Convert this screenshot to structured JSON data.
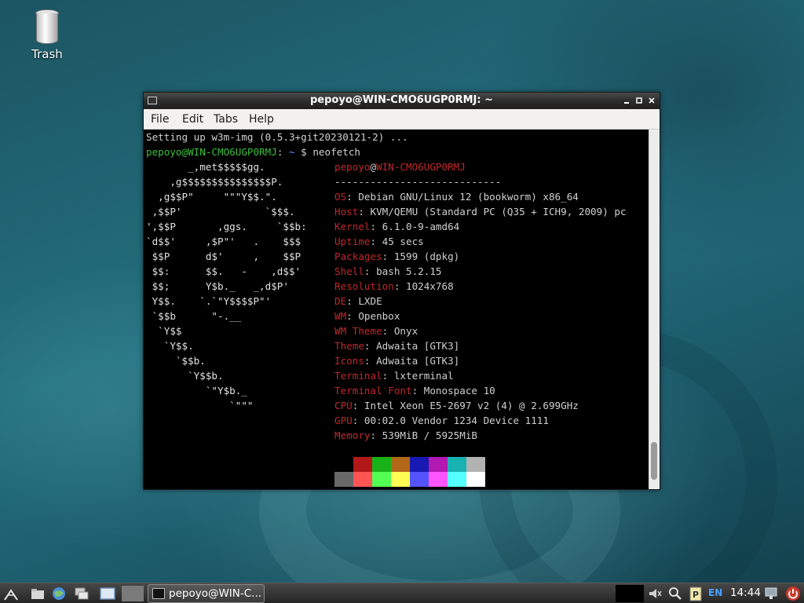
{
  "desktop": {
    "icons": [
      {
        "label": "Trash",
        "icon": "trash-icon"
      }
    ]
  },
  "window": {
    "title": "pepoyo@WIN-CMO6UGP0RMJ: ~",
    "menu": [
      "File",
      "Edit",
      "Tabs",
      "Help"
    ]
  },
  "terminal": {
    "setup_line": "Setting up w3m-img (0.5.3+git20230121-2) ...",
    "prompt_user": "pepoyo@WIN-CMO6UGP0RMJ",
    "prompt_sep": ":",
    "prompt_path": " ~",
    "prompt_symbol": " $ ",
    "command": "neofetch",
    "logo": [
      "       _,met$$$$$gg.",
      "    ,g$$$$$$$$$$$$$$$P.",
      "  ,g$$P\"     \"\"\"Y$$.\".",
      " ,$$P'              `$$$.",
      "',$$P       ,ggs.     `$$b:",
      "`d$$'     ,$P\"'   .    $$$",
      " $$P      d$'     ,    $$P",
      " $$:      $$.   -    ,d$$'",
      " $$;      Y$b._   _,d$P'",
      " Y$$.    `.`\"Y$$$$P\"'",
      " `$$b      \"-.__",
      "  `Y$$",
      "   `Y$$.",
      "     `$$b.",
      "       `Y$$b.",
      "          `\"Y$b._",
      "              `\"\"\""
    ],
    "host_user": "pepoyo",
    "host_at": "@",
    "host_name": "WIN-CMO6UGP0RMJ",
    "separator": "----------------------------",
    "info": [
      {
        "key": "OS",
        "value": "Debian GNU/Linux 12 (bookworm) x86_64"
      },
      {
        "key": "Host",
        "value": "KVM/QEMU (Standard PC (Q35 + ICH9, 2009) pc"
      },
      {
        "key": "Kernel",
        "value": "6.1.0-9-amd64"
      },
      {
        "key": "Uptime",
        "value": "45 secs"
      },
      {
        "key": "Packages",
        "value": "1599 (dpkg)"
      },
      {
        "key": "Shell",
        "value": "bash 5.2.15"
      },
      {
        "key": "Resolution",
        "value": "1024x768"
      },
      {
        "key": "DE",
        "value": "LXDE"
      },
      {
        "key": "WM",
        "value": "Openbox"
      },
      {
        "key": "WM Theme",
        "value": "Onyx"
      },
      {
        "key": "Theme",
        "value": "Adwaita [GTK3]"
      },
      {
        "key": "Icons",
        "value": "Adwaita [GTK3]"
      },
      {
        "key": "Terminal",
        "value": "lxterminal"
      },
      {
        "key": "Terminal Font",
        "value": "Monospace 10"
      },
      {
        "key": "CPU",
        "value": "Intel Xeon E5-2697 v2 (4) @ 2.699GHz"
      },
      {
        "key": "GPU",
        "value": "00:02.0 Vendor 1234 Device 1111"
      },
      {
        "key": "Memory",
        "value": "539MiB / 5925MiB"
      }
    ],
    "info_sep": ": ",
    "palette_top": [
      "#000000",
      "#b21818",
      "#18b218",
      "#b26818",
      "#1818b2",
      "#b218b2",
      "#18b2b2",
      "#b2b2b2"
    ],
    "palette_bottom": [
      "#686868",
      "#ff5454",
      "#54ff54",
      "#ffff54",
      "#5454ff",
      "#ff54ff",
      "#54ffff",
      "#ffffff"
    ],
    "colors": {
      "red": "#c0282a",
      "green": "#3bbf3b",
      "blue": "#6e8cff",
      "fg": "#d0d0d0"
    }
  },
  "taskbar": {
    "window_button": "pepoyo@WIN-C...",
    "keyboard_layout": "EN",
    "clock": "14:44",
    "launchers": [
      "menu-icon",
      "folder-icon",
      "browser-icon",
      "switch-windows-icon",
      "show-desktop-icon"
    ],
    "tray": [
      "volume-icon",
      "search-icon",
      "clipboard-icon",
      "network-icon",
      "power-icon"
    ]
  }
}
